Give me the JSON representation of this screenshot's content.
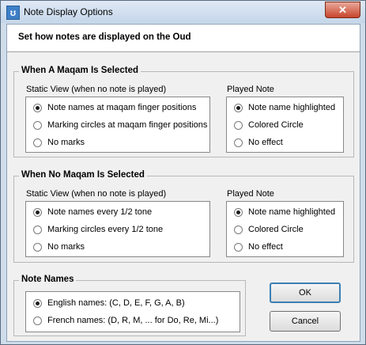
{
  "window": {
    "title": "Note Display Options",
    "icon_glyph": "ʊ",
    "close_glyph": "✕"
  },
  "header": {
    "text": "Set how notes are displayed on the Oud"
  },
  "maqam_group": {
    "title": "When A Maqam Is Selected",
    "static_label": "Static View (when no note is played)",
    "static_options": [
      "Note names at maqam finger positions",
      "Marking circles at maqam finger positions",
      "No marks"
    ],
    "played_label": "Played Note",
    "played_options": [
      "Note name highlighted",
      "Colored Circle",
      "No effect"
    ]
  },
  "no_maqam_group": {
    "title": "When No Maqam Is Selected",
    "static_label": "Static View (when no note is played)",
    "static_options": [
      "Note names every 1/2 tone",
      "Marking circles every 1/2 tone",
      "No marks"
    ],
    "played_label": "Played Note",
    "played_options": [
      "Note name highlighted",
      "Colored Circle",
      "No effect"
    ]
  },
  "note_names_group": {
    "title": "Note Names",
    "options": [
      "English names: (C, D, E, F, G, A, B)",
      "French names: (D, R, M, ... for Do, Re, Mi...)"
    ]
  },
  "buttons": {
    "ok": "OK",
    "cancel": "Cancel"
  }
}
